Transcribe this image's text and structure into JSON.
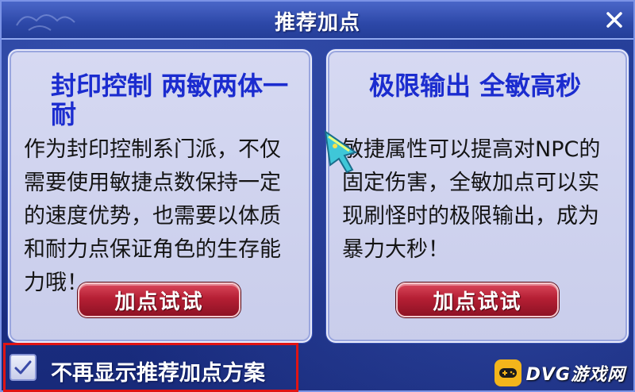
{
  "dialog": {
    "title": "推荐加点",
    "close_icon": "close-icon"
  },
  "panels": [
    {
      "heading": "封印控制 两敏两体一耐",
      "description": "作为封印控制系门派，不仅需要使用敏捷点数保持一定的速度优势，也需要以体质和耐力点保证角色的生存能力哦！",
      "button_label": "加点试试"
    },
    {
      "heading": "极限输出 全敏高秒",
      "description": "敏捷属性可以提高对NPC的固定伤害，全敏加点可以实现刷怪时的极限输出，成为暴力大秒！",
      "button_label": "加点试试"
    }
  ],
  "footer": {
    "checkbox_checked": true,
    "checkbox_label": "不再显示推荐加点方案"
  },
  "watermark": {
    "text": "DVG游戏网"
  },
  "colors": {
    "heading": "#1b2ccf",
    "button": "#b51f34",
    "highlight": "#e01414",
    "background": "#1c3189"
  }
}
